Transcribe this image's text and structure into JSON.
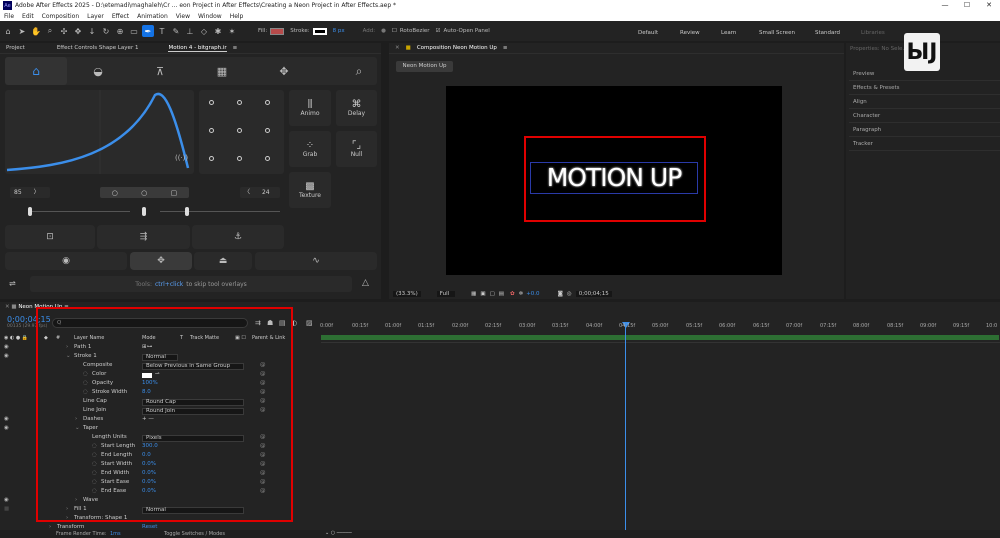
{
  "titlebar": {
    "text": "Adobe After Effects 2025 - D:\\etemadi\\maghaleh\\Cr ... eon Project in After Effects\\Creating a Neon Project in After Effects.aep *",
    "app_icon": "Ae"
  },
  "menu": [
    "File",
    "Edit",
    "Composition",
    "Layer",
    "Effect",
    "Animation",
    "View",
    "Window",
    "Help"
  ],
  "toolbar": {
    "fill_label": "Fill:",
    "stroke_label": "Stroke:",
    "stroke_width": "8 px",
    "add_label": "Add:",
    "rotobezier": "RotoBezier",
    "auto_open": "Auto-Open Panel",
    "workspaces": [
      "Default",
      "Review",
      "Learn",
      "Small Screen",
      "Standard",
      "Libraries"
    ],
    "fill_color": "#b74b4b",
    "stroke_color": "#ffffff",
    "accent": "#1473e6"
  },
  "left_tabs": [
    "Project",
    "Effect Controls Shape Layer 1",
    "Motion 4 - bitgraph.ir"
  ],
  "motion": {
    "val_left": "85",
    "val_right": "24",
    "buttons": [
      "Animo",
      "Delay",
      "Grab",
      "Null",
      "Texture"
    ],
    "tools_prefix": "Tools:",
    "tools_key": "ctrl+click",
    "tools_suffix": "to skip tool overlays"
  },
  "comp": {
    "tab": "Composition Neon Motion Up",
    "breadcrumb": "Neon Motion Up",
    "neon_text": "MOTION UP",
    "zoom": "(33.3%)",
    "resolution": "Full",
    "exposure": "+0.0",
    "timecode": "0;00;04;15"
  },
  "right_panel": [
    "Properties: No Sele...",
    "Preview",
    "Effects & Presets",
    "Align",
    "Character",
    "Paragraph",
    "Tracker"
  ],
  "timeline": {
    "tab": "Neon Motion Up",
    "timecode": "0;00;04;15",
    "fps": "00135 (29.97 fps)",
    "search_placeholder": "Q",
    "headers": {
      "layer_name": "Layer Name",
      "mode": "Mode",
      "track_matte": "Track Matte",
      "parent": "Parent & Link"
    },
    "ruler": [
      "0:00f",
      "00:15f",
      "01:00f",
      "01:15f",
      "02:00f",
      "02:15f",
      "03:00f",
      "03:15f",
      "04:00f",
      "04:15f",
      "05:00f",
      "05:15f",
      "06:00f",
      "06:15f",
      "07:00f",
      "07:15f",
      "08:00f",
      "08:15f",
      "09:00f",
      "09:15f",
      "10:0"
    ],
    "rows": [
      {
        "name": "Path 1",
        "indent": 1
      },
      {
        "name": "Stroke 1",
        "indent": 1,
        "dropdown": "Normal"
      },
      {
        "name": "Composite",
        "indent": 2,
        "dropdown": "Below Previous in Same Group"
      },
      {
        "name": "Color",
        "indent": 2,
        "swatch": true
      },
      {
        "name": "Opacity",
        "indent": 2,
        "value": "100%"
      },
      {
        "name": "Stroke Width",
        "indent": 2,
        "value": "8.0"
      },
      {
        "name": "Line Cap",
        "indent": 2,
        "dropdown": "Round Cap"
      },
      {
        "name": "Line Join",
        "indent": 2,
        "dropdown": "Round Join"
      },
      {
        "name": "Dashes",
        "indent": 1,
        "value": "+ —"
      },
      {
        "name": "Taper",
        "indent": 1
      },
      {
        "name": "Length Units",
        "indent": 2,
        "dropdown": "Pixels"
      },
      {
        "name": "Start Length",
        "indent": 2,
        "value": "300.0"
      },
      {
        "name": "End Length",
        "indent": 2,
        "value": "0.0"
      },
      {
        "name": "Start Width",
        "indent": 2,
        "value": "0.0%"
      },
      {
        "name": "End Width",
        "indent": 2,
        "value": "0.0%"
      },
      {
        "name": "Start Ease",
        "indent": 2,
        "value": "0.0%"
      },
      {
        "name": "End Ease",
        "indent": 2,
        "value": "0.0%"
      },
      {
        "name": "Wave",
        "indent": 1
      },
      {
        "name": "Fill 1",
        "indent": 1,
        "dropdown": "Normal"
      },
      {
        "name": "Transform: Shape 1",
        "indent": 1
      },
      {
        "name": "Transform",
        "indent": 0,
        "value": "Reset"
      }
    ],
    "footer_left": "Frame Render Time:",
    "footer_time": "1ms",
    "footer_right": "Toggle Switches / Modes"
  },
  "highlight_color": "#e00000",
  "watermark": "logo"
}
